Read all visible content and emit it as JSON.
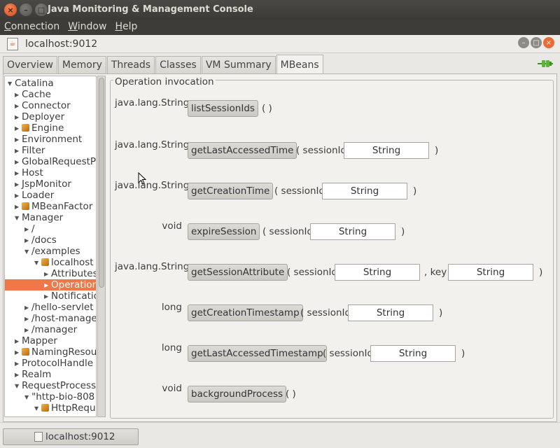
{
  "window": {
    "title": "Java Monitoring & Management Console",
    "menu": [
      {
        "label": "Connection",
        "underline": "C"
      },
      {
        "label": "Window",
        "underline": "W"
      },
      {
        "label": "Help",
        "underline": "H"
      }
    ]
  },
  "connection": {
    "title": "localhost:9012"
  },
  "tabs": [
    "Overview",
    "Memory",
    "Threads",
    "Classes",
    "VM Summary",
    "MBeans"
  ],
  "active_tab": "MBeans",
  "tree": [
    {
      "label": "Catalina",
      "arrow": "down",
      "bean": false
    },
    {
      "label": "Cache",
      "arrow": "right",
      "bean": false
    },
    {
      "label": "Connector",
      "arrow": "right",
      "bean": false
    },
    {
      "label": "Deployer",
      "arrow": "right",
      "bean": false
    },
    {
      "label": "Engine",
      "arrow": "right",
      "bean": true
    },
    {
      "label": "Environment",
      "arrow": "right",
      "bean": false
    },
    {
      "label": "Filter",
      "arrow": "right",
      "bean": false
    },
    {
      "label": "GlobalRequestP",
      "arrow": "right",
      "bean": false
    },
    {
      "label": "Host",
      "arrow": "right",
      "bean": false
    },
    {
      "label": "JspMonitor",
      "arrow": "right",
      "bean": false
    },
    {
      "label": "Loader",
      "arrow": "right",
      "bean": false
    },
    {
      "label": "MBeanFactor",
      "arrow": "right",
      "bean": true
    },
    {
      "label": "Manager",
      "arrow": "down",
      "bean": false
    },
    {
      "label": "/",
      "arrow": "right",
      "bean": false
    },
    {
      "label": "/docs",
      "arrow": "right",
      "bean": false
    },
    {
      "label": "/examples",
      "arrow": "down",
      "bean": false
    },
    {
      "label": "localhost",
      "arrow": "down",
      "bean": true
    },
    {
      "label": "Attributes",
      "arrow": "right",
      "bean": false
    },
    {
      "label": "Operation",
      "arrow": "right",
      "bean": false,
      "selected": true
    },
    {
      "label": "Notificatio",
      "arrow": "right",
      "bean": false
    },
    {
      "label": "/hello-servlet",
      "arrow": "right",
      "bean": false
    },
    {
      "label": "/host-manage",
      "arrow": "right",
      "bean": false
    },
    {
      "label": "/manager",
      "arrow": "right",
      "bean": false
    },
    {
      "label": "Mapper",
      "arrow": "right",
      "bean": false
    },
    {
      "label": "NamingResou",
      "arrow": "right",
      "bean": true
    },
    {
      "label": "ProtocolHandle",
      "arrow": "right",
      "bean": false
    },
    {
      "label": "Realm",
      "arrow": "right",
      "bean": false
    },
    {
      "label": "RequestProcess",
      "arrow": "down",
      "bean": false
    },
    {
      "label": "\"http-bio-808",
      "arrow": "down",
      "bean": false
    },
    {
      "label": "HttpRequ",
      "arrow": "down",
      "bean": true
    }
  ],
  "operations_panel": {
    "title": "Operation invocation",
    "operations": [
      {
        "return_type": "java.lang.String",
        "name": "listSessionIds",
        "params": [],
        "suffix": "( )"
      },
      {
        "return_type": "java.lang.String",
        "name": "getLastAccessedTime",
        "params": [
          {
            "label": "( sessionId",
            "value": "String"
          }
        ],
        "suffix": ")"
      },
      {
        "return_type": "java.lang.String",
        "name": "getCreationTime",
        "params": [
          {
            "label": "( sessionId",
            "value": "String"
          }
        ],
        "suffix": ")"
      },
      {
        "return_type": "void",
        "name": "expireSession",
        "params": [
          {
            "label": "( sessionId",
            "value": "String"
          }
        ],
        "suffix": ")"
      },
      {
        "return_type": "java.lang.String",
        "name": "getSessionAttribute",
        "params": [
          {
            "label": "( sessionId",
            "value": "String"
          },
          {
            "label": ", key",
            "value": "String"
          }
        ],
        "suffix": ")"
      },
      {
        "return_type": "long",
        "name": "getCreationTimestamp",
        "params": [
          {
            "label": "( sessionId",
            "value": "String"
          }
        ],
        "suffix": ")"
      },
      {
        "return_type": "long",
        "name": "getLastAccessedTimestamp",
        "params": [
          {
            "label": "( sessionId",
            "value": "String"
          }
        ],
        "suffix": ")"
      },
      {
        "return_type": "void",
        "name": "backgroundProcess",
        "params": [],
        "suffix": "( )"
      }
    ]
  },
  "taskbar": {
    "item_label": "localhost:9012"
  },
  "colors": {
    "selection": "#f07746",
    "titlebar": "#3d3c38",
    "close_button": "#ee6a35"
  }
}
